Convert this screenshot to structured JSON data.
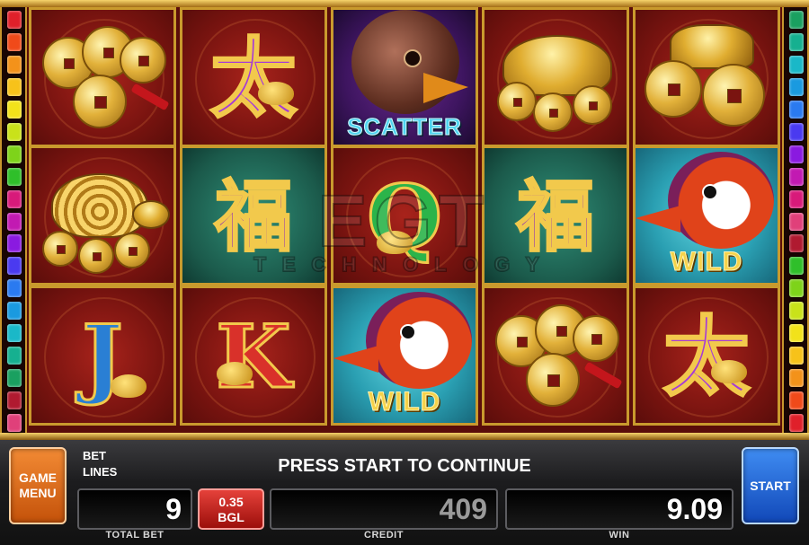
{
  "reels": {
    "grid": [
      [
        "Coins",
        "Letter Tai",
        "Duck Scatter",
        "Toad",
        "Ingots"
      ],
      [
        "Turtle",
        "Fu",
        "Letter Q",
        "Fu",
        "Duck Wild"
      ],
      [
        "Letter J",
        "Letter K",
        "Duck Wild",
        "Coins",
        "Letter Tai"
      ]
    ],
    "scatter_label": "SCATTER",
    "wild_label": "WILD",
    "fu_char": "福",
    "tai_char": "太",
    "q_char": "Q",
    "j_char": "J",
    "k_char": "K"
  },
  "watermark": {
    "main": "EGT",
    "sub": "TECHNOLOGY"
  },
  "line_lamps": {
    "left_colors": [
      "#e0202a",
      "#f04a1a",
      "#f3921a",
      "#f7c21a",
      "#f2e21a",
      "#c9e21a",
      "#7ed31a",
      "#2fbf2a",
      "#d81a7a",
      "#c21ab2",
      "#8a1ae0",
      "#4a3af0",
      "#2a7af0",
      "#1a9ae0",
      "#1ab8c8",
      "#16b090",
      "#1aa060",
      "#b01a30",
      "#e0407a"
    ],
    "right_colors": [
      "#1aa060",
      "#16b090",
      "#1ab8c8",
      "#1a9ae0",
      "#2a7af0",
      "#4a3af0",
      "#8a1ae0",
      "#c21ab2",
      "#d81a7a",
      "#e0407a",
      "#b01a30",
      "#2fbf2a",
      "#7ed31a",
      "#c9e21a",
      "#f2e21a",
      "#f7c21a",
      "#f3921a",
      "#f04a1a",
      "#e0202a"
    ]
  },
  "panel": {
    "menu_label": "GAME MENU",
    "start_label": "START",
    "bet_label": "BET",
    "lines_label": "LINES",
    "message": "PRESS START TO CONTINUE",
    "total_bet_value": "9",
    "total_bet_caption": "TOTAL BET",
    "denom_value": "0.35",
    "denom_currency": "BGL",
    "credit_value": "409",
    "credit_caption": "CREDIT",
    "win_value": "9.09",
    "win_caption": "WIN"
  },
  "colors": {
    "frame_gold": "#c99a2d",
    "reel_red": "#7a1410",
    "menu_orange": "#e0701e",
    "start_blue": "#2a6ad8",
    "credit_text": "#9a9a9a",
    "win_text": "#ffffff"
  }
}
